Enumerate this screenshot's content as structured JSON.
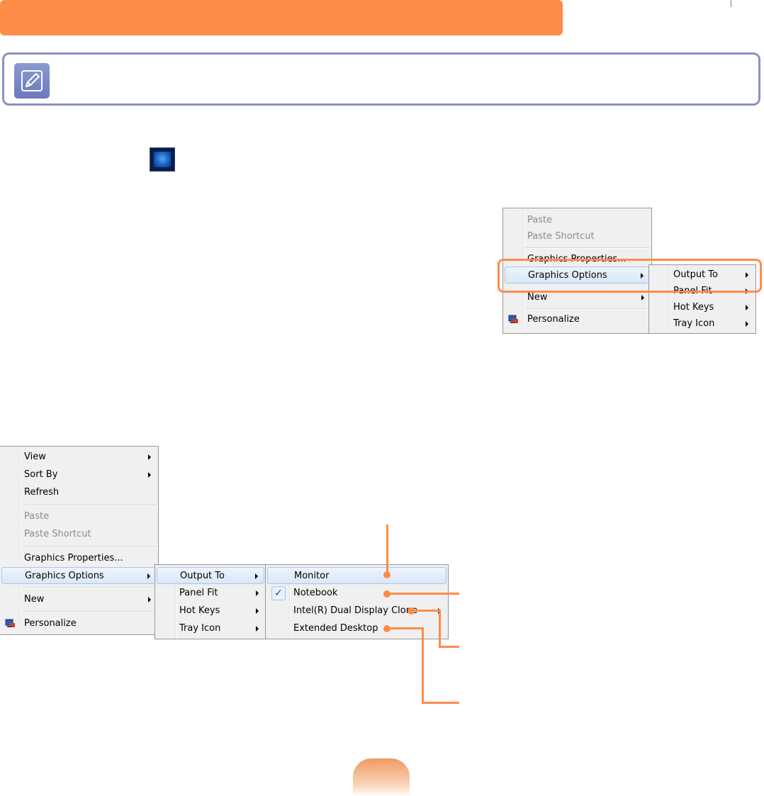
{
  "colors": {
    "accent": "#fe8c49",
    "note_border": "#8992bf",
    "menu_bg": "#f0f0f0"
  },
  "icons": [
    "pencil-note-icon",
    "intel-graphics-tray-icon",
    "personalize-icon",
    "submenu-arrow-icon",
    "check-icon"
  ],
  "top_menu": {
    "main_items": {
      "paste": "Paste",
      "paste_shortcut": "Paste Shortcut",
      "graphics_properties": "Graphics Properties...",
      "graphics_options": "Graphics Options",
      "new": "New",
      "personalize": "Personalize"
    },
    "submenu": {
      "output_to": "Output To",
      "panel_fit": "Panel Fit",
      "hot_keys": "Hot Keys",
      "tray_icon": "Tray Icon"
    }
  },
  "bottom_menu": {
    "main_items": {
      "view": "View",
      "sort_by": "Sort By",
      "refresh": "Refresh",
      "paste": "Paste",
      "paste_shortcut": "Paste Shortcut",
      "graphics_properties": "Graphics Properties...",
      "graphics_options": "Graphics Options",
      "new": "New",
      "personalize": "Personalize"
    },
    "submenu": {
      "output_to": "Output To",
      "panel_fit": "Panel Fit",
      "hot_keys": "Hot Keys",
      "tray_icon": "Tray Icon"
    },
    "output_submenu": {
      "monitor": "Monitor",
      "notebook": "Notebook",
      "dual_clone": "Intel(R) Dual Display Clone",
      "extended": "Extended Desktop",
      "check_mark": "✓"
    }
  }
}
